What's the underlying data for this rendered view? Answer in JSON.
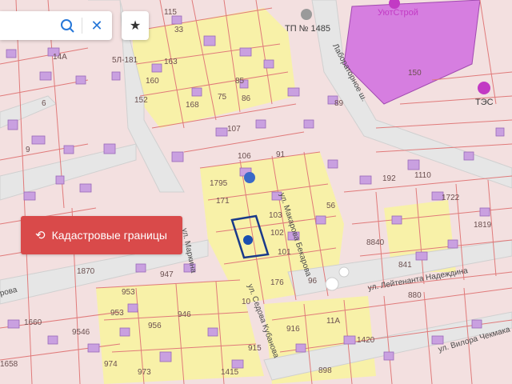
{
  "search": {
    "value": "",
    "placeholder": ""
  },
  "buttons": {
    "cadastral_label": "Кадастровые границы"
  },
  "poi": {
    "shop": "УютСтрой",
    "tp": "ТП № 1485",
    "tes": "ТЭС"
  },
  "streets": {
    "laboratornoe": "Лабораторное ш.",
    "makarova": "ул. Макарова Бекарова",
    "leytenanta": "ул. Лейтенанта Надеждина",
    "sedova": "ул. Седова Кубанова",
    "markina": "ул. Маркина",
    "vilora": "ул. Вилора Чекмака",
    "rova": "рова"
  },
  "parcel_labels": [
    "115",
    "33",
    "163",
    "5Л-181",
    "14А",
    "85",
    "160",
    "150",
    "6",
    "152",
    "168",
    "75",
    "86",
    "89",
    "107",
    "91",
    "9",
    "106",
    "1795",
    "171",
    "103",
    "102",
    "101",
    "176",
    "192",
    "1110",
    "1722",
    "1819",
    "8840",
    "841",
    "880",
    "1870",
    "947",
    "953",
    "953",
    "1660",
    "9546",
    "956",
    "974",
    "1658",
    "973",
    "10",
    "915",
    "916",
    "11А",
    "898",
    "1420",
    "1415",
    "946",
    "96",
    "56"
  ],
  "colors": {
    "parcel_bg": "#f3e0e0",
    "parcel_line": "#e07a7a",
    "yellow": "#f8f1a8",
    "building": "#c9a0e0",
    "shop": "#d67ee0",
    "accent": "#2677d8",
    "button_red": "#d94a4a"
  }
}
